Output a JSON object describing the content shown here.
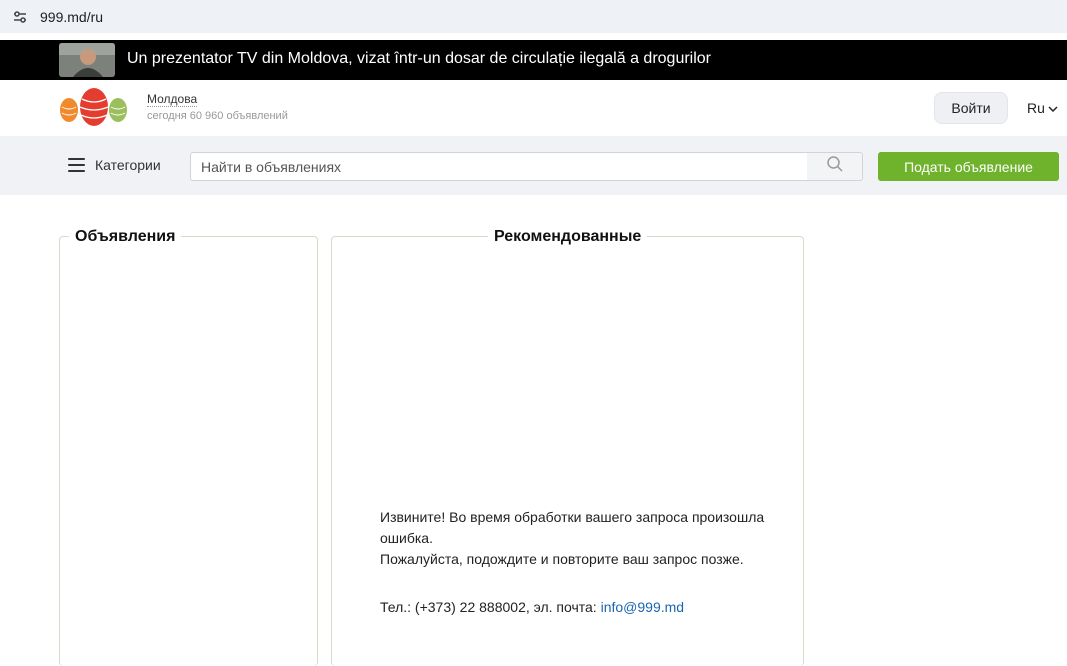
{
  "browser": {
    "url": "999.md/ru"
  },
  "news_banner": {
    "headline": "Un prezentator TV din Moldova, vizat într-un dosar de circulație ilegală a drogurilor"
  },
  "header": {
    "region": "Молдова",
    "ads_count": "сегодня 60 960 объявлений",
    "login_label": "Войти",
    "language": "Ru"
  },
  "search": {
    "categories_label": "Категории",
    "placeholder": "Найти в объявлениях",
    "post_ad_label": "Подать объявление"
  },
  "panels": {
    "left_title": "Объявления",
    "right_title": "Рекомендованные"
  },
  "error": {
    "line1": "Извините! Во время обработки вашего запроса произошла ошибка.",
    "line2": "Пожалуйста, подождите и повторите ваш запрос позже.",
    "contact_prefix": "Тел.: (+373) 22 888002, эл. почта:",
    "email": "info@999.md"
  },
  "colors": {
    "accent_green": "#6fb22b",
    "link_blue": "#1a66b3",
    "news_bar": "#000000"
  }
}
